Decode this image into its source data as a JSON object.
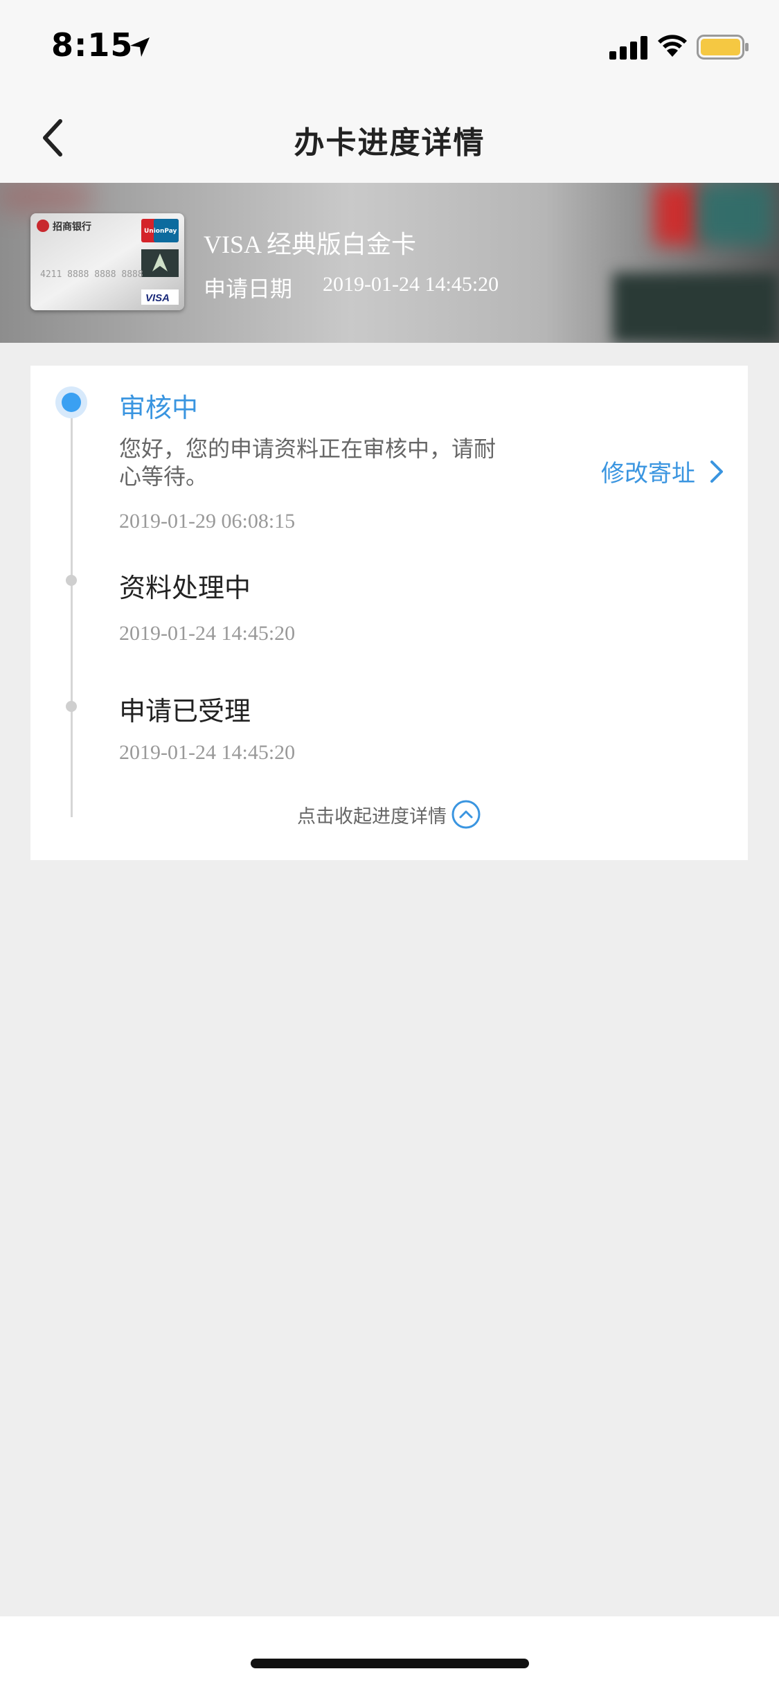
{
  "status": {
    "time": "8:15"
  },
  "nav": {
    "title": "办卡进度详情"
  },
  "card": {
    "bank_name": "招商银行",
    "network_badge": "UnionPay 银联",
    "visa_badge": "VISA",
    "name": "VISA 经典版白金卡",
    "date_label": "申请日期",
    "date_value": "2019-01-24 14:45:20"
  },
  "progress": {
    "steps": [
      {
        "title": "审核中",
        "desc": "您好，您的申请资料正在审核中，请耐心等待。",
        "time": "2019-01-29 06:08:15",
        "active": true
      },
      {
        "title": "资料处理中",
        "time": "2019-01-24 14:45:20",
        "active": false
      },
      {
        "title": "申请已受理",
        "time": "2019-01-24 14:45:20",
        "active": false
      }
    ],
    "modify_link": "修改寄址",
    "collapse_label": "点击收起进度详情"
  },
  "colors": {
    "accent": "#3a95e0",
    "background": "#eeeeee",
    "card_bg": "#ffffff"
  }
}
